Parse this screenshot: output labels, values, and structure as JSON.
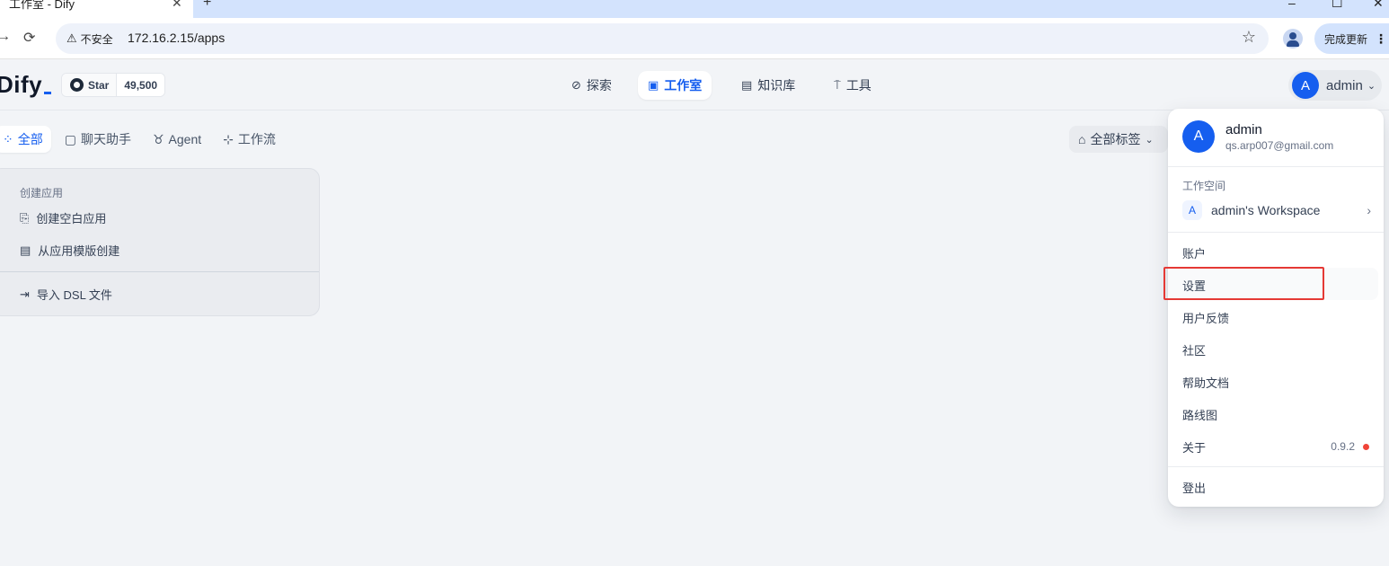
{
  "browser": {
    "tab_title": "工作室 - Dify",
    "tab_close": "✕",
    "new_tab": "+",
    "security_label": "不安全",
    "url": "172.16.2.15/apps",
    "update_label": "完成更新",
    "icons": {
      "back": "arrow-right-icon",
      "reload": "reload-icon",
      "star": "bookmark-star-icon",
      "profile": "profile-icon"
    }
  },
  "header": {
    "logo": "Dify",
    "github_star_label": "Star",
    "github_star_count": "49,500",
    "nav": [
      {
        "label": "探索",
        "icon": "compass-icon"
      },
      {
        "label": "工作室",
        "icon": "robot-icon",
        "active": true
      },
      {
        "label": "知识库",
        "icon": "book-icon"
      },
      {
        "label": "工具",
        "icon": "hammer-icon"
      }
    ],
    "user": {
      "initial": "A",
      "name": "admin"
    }
  },
  "filters": {
    "items": [
      {
        "label": "全部",
        "active": true
      },
      {
        "label": "聊天助手"
      },
      {
        "label": "Agent"
      },
      {
        "label": "工作流"
      }
    ],
    "tag_filter": "全部标签"
  },
  "create_card": {
    "title": "创建应用",
    "create_blank": "创建空白应用",
    "create_from_template": "从应用模版创建",
    "import_dsl": "导入 DSL 文件"
  },
  "user_menu": {
    "name": "admin",
    "email": "qs.arp007@gmail.com",
    "initial": "A",
    "workspace_label": "工作空间",
    "workspace_initial": "A",
    "workspace_name": "admin's Workspace",
    "items": {
      "account": "账户",
      "settings": "设置",
      "feedback": "用户反馈",
      "community": "社区",
      "docs": "帮助文档",
      "roadmap": "路线图",
      "about": "关于",
      "logout": "登出"
    },
    "version": "0.9.2"
  },
  "colors": {
    "accent": "#155eef",
    "highlight": "#e53935",
    "version_dot": "#f04438"
  }
}
